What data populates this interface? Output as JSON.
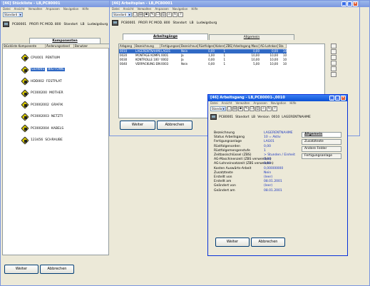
{
  "main": {
    "title": "[46] Stückliste - LB,PC80001",
    "menu": [
      "Datei",
      "Ansicht",
      "Verwalten",
      "Anpassen",
      "Navigation",
      "Hilfe"
    ],
    "select": "Standard",
    "header": {
      "code": "PC80001",
      "name": "PROFI PC MOD. 800",
      "standort_label": "Standort",
      "standort": "LB",
      "ort": "Ludwigsburg"
    },
    "tab": "Komponenten",
    "columns": [
      "Stückliste Komponente",
      "Änderungsstand",
      "Benutzer"
    ],
    "tree": [
      {
        "code": "CPU001",
        "name": "PENTIUM"
      },
      {
        "code": "GEH001",
        "name": "BIG-TOWE"
      },
      {
        "code": "HDD002",
        "name": "FESTPLAT"
      },
      {
        "code": "PC000200",
        "name": "MOTHER"
      },
      {
        "code": "PC0002002",
        "name": "GRAFIK"
      },
      {
        "code": "PC0002003",
        "name": "NETZTI"
      },
      {
        "code": "PC0002004",
        "name": "KABELS"
      },
      {
        "code": "123456",
        "name": "SCHRAUBE"
      }
    ],
    "btn_next": "Weiter",
    "btn_cancel": "Abbrechen"
  },
  "arbeitsplan": {
    "title": "[46] Arbeitsplan - LB,PC80001",
    "menu": [
      "Datei",
      "Ansicht",
      "Verwalten",
      "Anpassen",
      "Navigation",
      "Hilfe"
    ],
    "select": "Standard",
    "header": {
      "code": "PC80001",
      "name": "PROFI PC MOD. 800",
      "standort_label": "Standort",
      "standort": "LB",
      "ort": "Ludwigsburg"
    },
    "tabs": [
      "Arbeitsgänge",
      "Allgemein"
    ],
    "columns": [
      "Arbgang",
      "Bezeichnung",
      "Fertigungsanlage",
      "Bezeichnungen",
      "Rüstfolgen",
      "Kolonne",
      "ZBS",
      "Arbeitsgang Maschine",
      "AG-Lohnkosten",
      "Sta"
    ],
    "rows": [
      [
        "0010",
        "LAGERENTNAHME",
        "LAG01",
        "Nein",
        "0,00",
        "1",
        "",
        "0,00",
        "0,00",
        "10"
      ],
      [
        "0020",
        "MONTAGE KOMPLETT",
        "0001",
        "Ja",
        "1,00",
        "1",
        "",
        "10,00",
        "10,00",
        "10"
      ],
      [
        "0030",
        "KONTROLLE 100 %",
        "0002",
        "Ja",
        "0,00",
        "1",
        "",
        "10,00",
        "10,00",
        "10"
      ],
      [
        "0040",
        "VERPACKUNG EINZEL",
        "0003",
        "Nein",
        "0,00",
        "1",
        "",
        "5,00",
        "10,00",
        "10"
      ]
    ],
    "btn_next": "Weiter",
    "btn_cancel": "Abbrechen"
  },
  "arbeitsgang": {
    "title": "[46] Arbeitsgang - LB,PC80001-,0010",
    "menu": [
      "Datei",
      "Ansicht",
      "Verwalten",
      "Anpassen",
      "Navigation",
      "Hilfe"
    ],
    "select": "Standard",
    "header": {
      "code": "PC80001",
      "standort_label": "Standort",
      "standort": "LB",
      "version_label": "Version",
      "version": "0010",
      "name": "LAGERENTNAHME"
    },
    "fields": [
      {
        "k": "Bezeichnung",
        "v": "LAGERENTNAHME"
      },
      {
        "k": "Status Arbeitsgang",
        "v": "10 = Aktiv"
      },
      {
        "k": "Fertigungsanlage",
        "v": "LAG01"
      },
      {
        "k": "Rüstfolgenorden",
        "v": "0,00"
      },
      {
        "k": "Rüstfolgemengenstufe",
        "v": "1"
      },
      {
        "k": "Zeitbasischlüssel (ZBS)",
        "v": "> Stunden / Einheit"
      },
      {
        "k": "AG-Maschinenzeit (ZBS verwenden)",
        "v": "0,00"
      },
      {
        "k": "AG-Lohneinsatzzeit (ZBS verwenden)",
        "v": "0,00"
      },
      {
        "k": "Kosten Auswärts-Arbeit",
        "v": "0,00000000"
      },
      {
        "k": "Zusatztexte",
        "v": "Nein"
      },
      {
        "k": "Erstellt von",
        "v": "(leer)"
      },
      {
        "k": "Erstellt am",
        "v": "08.01.2001"
      },
      {
        "k": "Geändert von",
        "v": "(leer)"
      },
      {
        "k": "Geändert am",
        "v": "08.01.2001"
      }
    ],
    "side_buttons": [
      "Allgemein",
      "Zusatztexte",
      "Andere Felder",
      "Fertigungsanlage"
    ],
    "btn_next": "Weiter",
    "btn_cancel": "Abbrechen"
  },
  "bottom": {
    "btn_next": "Weiter",
    "btn_cancel": "Abbrechen"
  }
}
